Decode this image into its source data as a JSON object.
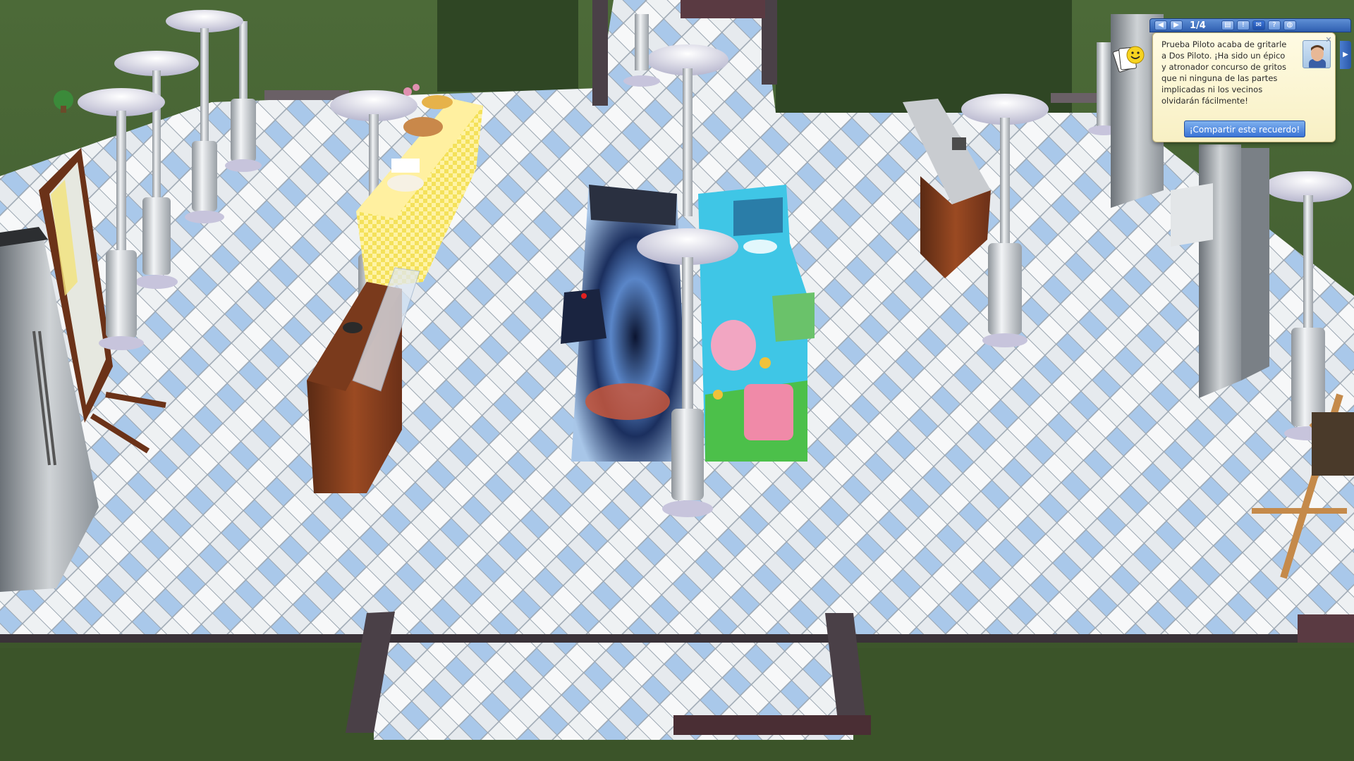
{
  "notification": {
    "page_counter": "1/4",
    "message": "Prueba Piloto acaba de gritarle a Dos Piloto. ¡Ha sido un épico y atronador concurso de gritos que ni ninguna de las partes implicadas ni los vecinos olvidarán fácilmente!",
    "share_button_label": "¡Compartir este recuerdo!",
    "icons": {
      "prev": "chevron-left-icon",
      "next": "chevron-right-icon",
      "close": "close-icon",
      "expand": "chevron-right-icon",
      "mood": "smiley-icon",
      "avatar": "sim-portrait"
    }
  },
  "scene": {
    "description_objects": [
      "arcade-cabinet",
      "arcade-cabinet",
      "buffet-table",
      "bar-counter",
      "refrigerator",
      "mirror",
      "easel",
      "patio-heater"
    ]
  },
  "colors": {
    "ui_blue": "#3a74d6",
    "card_bg": "#fffbe3",
    "floor_white": "#eef1f3",
    "floor_blue": "#a9c8ea",
    "grass": "#3f5a2e"
  }
}
